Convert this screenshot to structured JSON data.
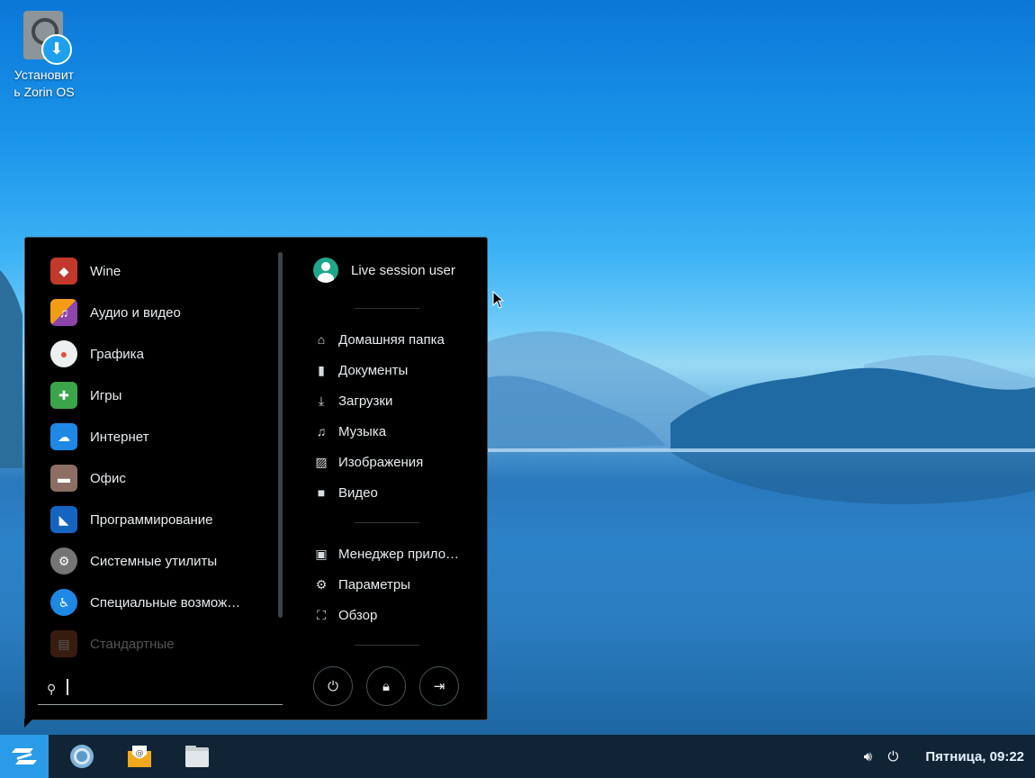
{
  "desktop": {
    "installer_icon": "disk-download-icon",
    "installer_label_line1": "Установит",
    "installer_label_line2": "ь Zorin OS"
  },
  "menu": {
    "categories": [
      {
        "label": "Wine",
        "icon": "wine-icon",
        "color": "#c0392b"
      },
      {
        "label": "Аудио и видео",
        "icon": "audio-video-icon",
        "color": "#f39c12"
      },
      {
        "label": "Графика",
        "icon": "palette-icon",
        "color": "#ecf0f1"
      },
      {
        "label": "Игры",
        "icon": "gamepad-icon",
        "color": "#3aa54a"
      },
      {
        "label": "Интернет",
        "icon": "cloud-icon",
        "color": "#1e88e5"
      },
      {
        "label": "Офис",
        "icon": "briefcase-icon",
        "color": "#8d6e63"
      },
      {
        "label": "Программирование",
        "icon": "programming-icon",
        "color": "#1565c0"
      },
      {
        "label": "Системные утилиты",
        "icon": "gear-icon",
        "color": "#9e9e9e"
      },
      {
        "label": "Специальные возмож…",
        "icon": "accessibility-icon",
        "color": "#1e88e5"
      },
      {
        "label": "Стандартные",
        "icon": "accessories-icon",
        "color": "#a0522d"
      }
    ],
    "search_placeholder": "",
    "user_name": "Live session user",
    "places": [
      {
        "label": "Домашняя папка",
        "icon": "home-icon"
      },
      {
        "label": "Документы",
        "icon": "document-icon"
      },
      {
        "label": "Загрузки",
        "icon": "download-icon"
      },
      {
        "label": "Музыка",
        "icon": "music-icon"
      },
      {
        "label": "Изображения",
        "icon": "image-icon"
      },
      {
        "label": "Видео",
        "icon": "video-icon"
      }
    ],
    "system": [
      {
        "label": "Менеджер прило…",
        "icon": "software-bag-icon"
      },
      {
        "label": "Параметры",
        "icon": "settings-gear-icon"
      },
      {
        "label": "Обзор",
        "icon": "overview-icon"
      }
    ],
    "session_buttons": [
      "power-icon",
      "lock-icon",
      "logout-icon"
    ]
  },
  "taskbar": {
    "apps": [
      "browser-icon",
      "mail-icon",
      "files-icon"
    ],
    "clock": "Пятница, 09:22",
    "accent": "#2a9be6"
  }
}
